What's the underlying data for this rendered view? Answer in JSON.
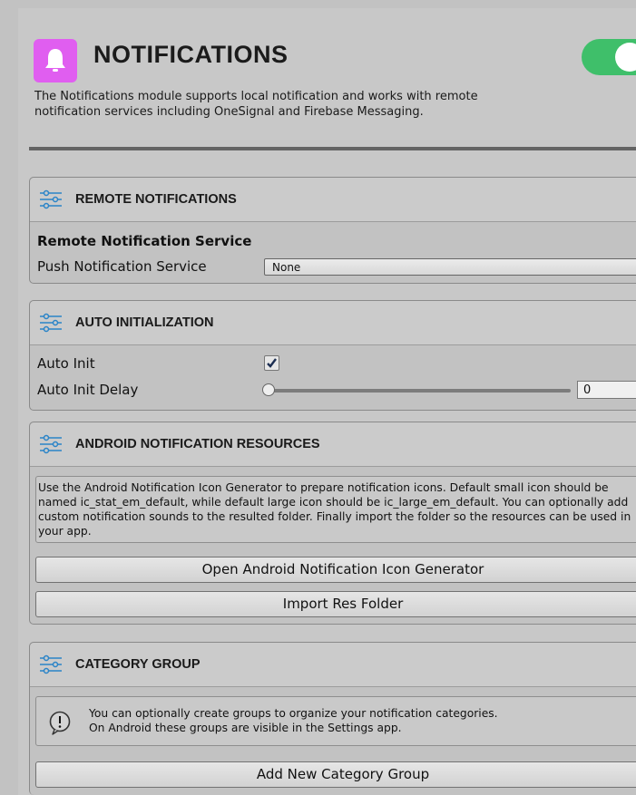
{
  "module": {
    "title": "NOTIFICATIONS",
    "description": "The Notifications module supports local notification and works with remote\nnotification services including OneSignal and Firebase Messaging.",
    "enabled": true,
    "accent_color": "#e05ef0",
    "toggle_color": "#3fbf6a"
  },
  "remote_notifications": {
    "title": "REMOTE NOTIFICATIONS",
    "subheading": "Remote Notification Service",
    "service_label": "Push Notification Service",
    "service_value": "None"
  },
  "auto_initialization": {
    "title": "AUTO INITIALIZATION",
    "auto_init_label": "Auto Init",
    "auto_init_checked": true,
    "delay_label": "Auto Init Delay",
    "delay_value": "0"
  },
  "android_resources": {
    "title": "ANDROID NOTIFICATION RESOURCES",
    "help_text": "Use the Android Notification Icon Generator to prepare notification icons. Default small icon should be named ic_stat_em_default, while default large icon should be ic_large_em_default. You can optionally add custom notification sounds to the resulted folder. Finally import the folder so the resources can be used in your app.",
    "open_generator_label": "Open Android Notification Icon Generator",
    "import_res_label": "Import Res Folder"
  },
  "category_group": {
    "title": "CATEGORY GROUP",
    "info_text": "You can optionally create groups to organize your notification categories.\nOn Android these groups are visible in the Settings app.",
    "add_group_label": "Add New Category Group"
  }
}
